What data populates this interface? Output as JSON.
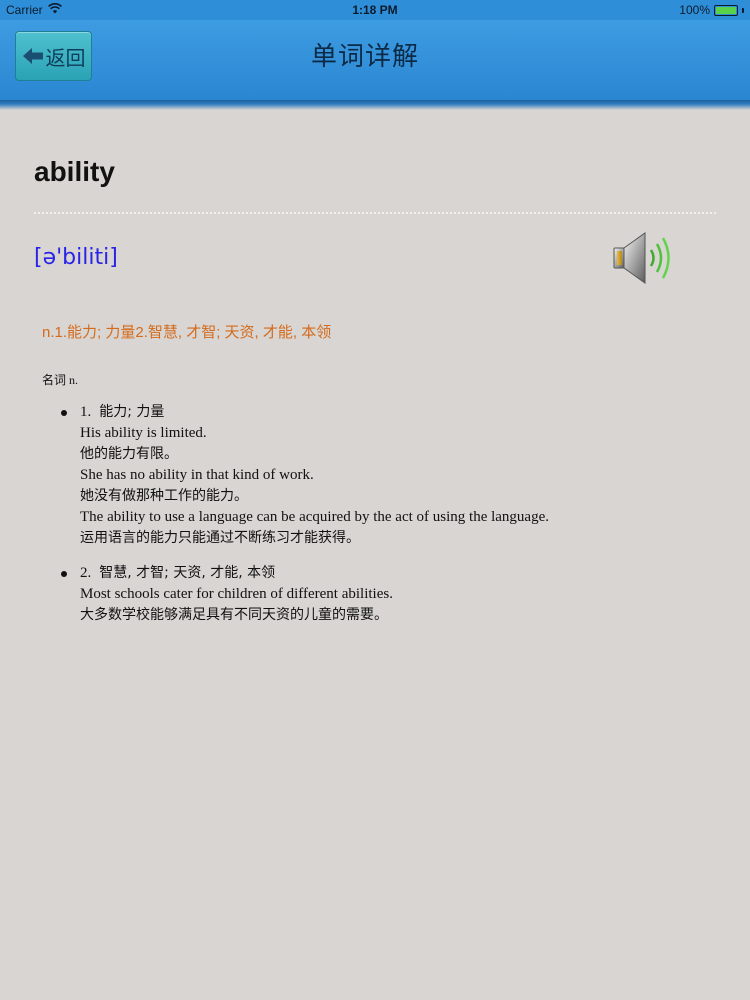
{
  "status_bar": {
    "carrier": "Carrier",
    "time": "1:18 PM",
    "battery": "100%",
    "battery_level": 1.0
  },
  "nav": {
    "back_label": "返回",
    "title": "单词详解"
  },
  "entry": {
    "word": "ability",
    "phonetic": "[ə'biliti]",
    "brief": "n.1.能力; 力量2.智慧, 才智; 天资, 才能, 本领",
    "part_of_speech": "名词 n.",
    "senses": [
      {
        "number": "1.",
        "meaning": "能力; 力量",
        "lines": [
          "His ability is limited.",
          "他的能力有限。",
          "She has no ability in that kind of work.",
          "她没有做那种工作的能力。",
          "The ability to use a language can be acquired by the act of using the language.",
          "运用语言的能力只能通过不断练习才能获得。"
        ]
      },
      {
        "number": "2.",
        "meaning": "智慧, 才智; 天资, 才能, 本领",
        "lines": [
          "Most schools cater for children of different abilities.",
          "大多数学校能够满足具有不同天资的儿童的需要。"
        ]
      }
    ]
  },
  "icons": {
    "wifi": "wifi-icon",
    "battery": "battery-icon",
    "back_arrow": "arrow-left-icon",
    "speaker": "speaker-icon"
  },
  "colors": {
    "nav_bar": "#2f8ed8",
    "back_button": "#3bb2c4",
    "phonetic": "#2a24e6",
    "brief": "#d46b1c",
    "background": "#d8d5d3"
  }
}
